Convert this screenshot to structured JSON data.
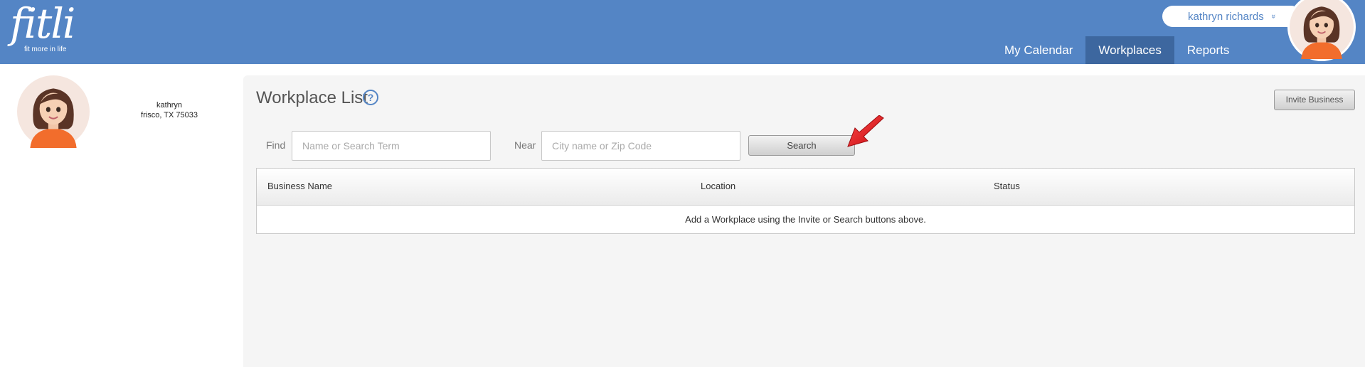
{
  "app": {
    "logo_text": "fitli",
    "logo_tagline": "fit more in life",
    "user_menu": {
      "label": "kathryn richards",
      "chevron": "»"
    }
  },
  "nav": {
    "items": [
      {
        "label": "My Calendar"
      },
      {
        "label": "Workplaces"
      },
      {
        "label": "Reports"
      }
    ]
  },
  "profile": {
    "name": "kathryn",
    "location": "frisco, TX 75033"
  },
  "page": {
    "title": "Workplace List",
    "help_icon": "?",
    "invite_button": "Invite Business",
    "find_label": "Find",
    "find_placeholder": "Name or Search Term",
    "near_label": "Near",
    "near_placeholder": "City name or Zip Code",
    "search_button": "Search"
  },
  "table": {
    "columns": [
      "Business Name",
      "Location",
      "Status"
    ],
    "empty_message": "Add a Workplace using the Invite or Search buttons above."
  },
  "colors": {
    "header_bg": "#5485c5",
    "nav_active_bg": "#3d679f",
    "main_bg": "#f5f5f5",
    "annotation_arrow": "#e8141b"
  }
}
